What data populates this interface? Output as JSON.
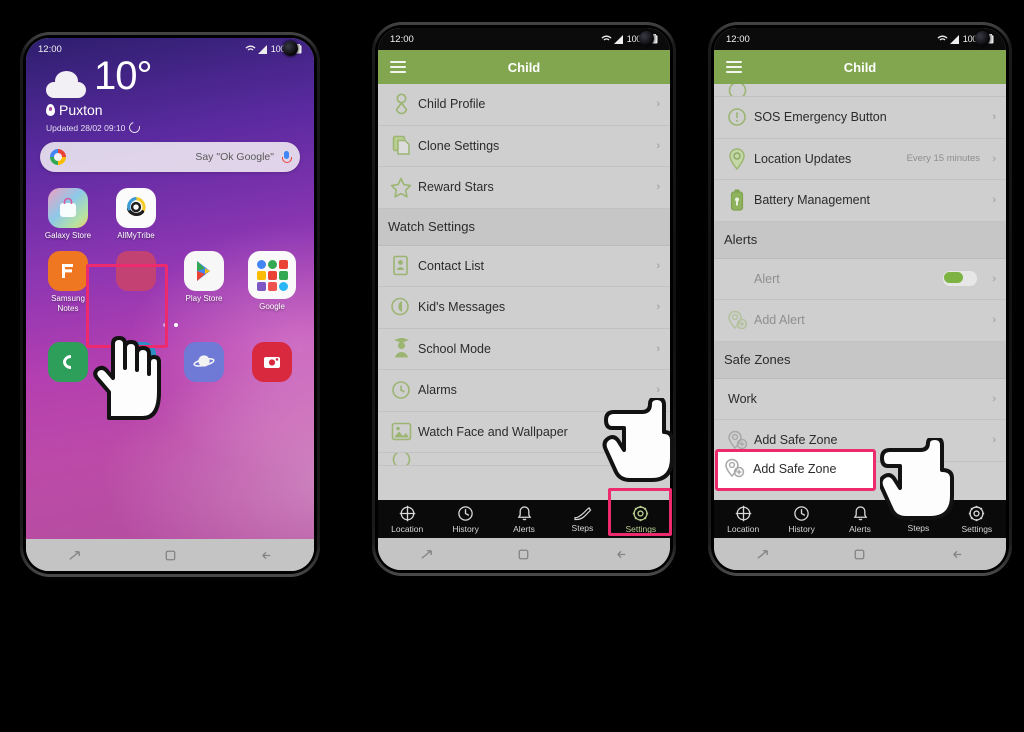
{
  "colors": {
    "brand_green": "#82a64f",
    "highlight_pink": "#ed2a6e",
    "icon_green": "#9cb573",
    "toggle_green": "#7cb342",
    "list_bg": "#cfcfcf",
    "tabbar_bg": "#0a0a0a"
  },
  "phone1": {
    "status": {
      "time": "12:00",
      "battery": "100%",
      "icons": "wifi-signal-battery"
    },
    "weather": {
      "temperature": "10°",
      "condition_icon": "cloud-icon",
      "location": "Puxton",
      "updated": "Updated 28/02 09:10"
    },
    "search": {
      "placeholder": "Say \"Ok Google\"",
      "logo": "google-g-icon",
      "mic": "microphone-icon"
    },
    "apps": [
      {
        "label": "Galaxy Store",
        "icon": "galaxy-store-icon"
      },
      {
        "label": "AllMyTribe",
        "icon": "allmytribe-icon",
        "highlighted": true
      },
      {
        "label": "Samsung Notes",
        "icon": "samsung-notes-icon"
      },
      {
        "label": "Play Store",
        "icon": "play-store-icon"
      },
      {
        "label": "Google",
        "icon": "google-folder-icon"
      }
    ],
    "dock": [
      {
        "label": "Phone",
        "icon": "phone-icon"
      },
      {
        "label": "Messages",
        "icon": "messages-icon"
      },
      {
        "label": "Internet",
        "icon": "internet-icon"
      },
      {
        "label": "Camera",
        "icon": "camera-icon"
      }
    ],
    "page_dots": 2,
    "active_dot": 2,
    "sysnav": [
      "recents-icon",
      "home-icon",
      "back-icon"
    ]
  },
  "phone2": {
    "status": {
      "time": "12:00",
      "battery": "100%"
    },
    "appbar": {
      "title": "Child",
      "menu_icon": "hamburger-icon"
    },
    "rows": [
      {
        "label": "Child Profile",
        "icon": "child-profile-icon",
        "type": "row"
      },
      {
        "label": "Clone Settings",
        "icon": "clone-settings-icon",
        "type": "row"
      },
      {
        "label": "Reward Stars",
        "icon": "star-icon",
        "type": "row"
      },
      {
        "label": "Watch Settings",
        "type": "section"
      },
      {
        "label": "Contact List",
        "icon": "contact-list-icon",
        "type": "row"
      },
      {
        "label": "Kid's Messages",
        "icon": "messages-bubble-icon",
        "type": "row"
      },
      {
        "label": "School Mode",
        "icon": "school-mode-icon",
        "type": "row"
      },
      {
        "label": "Alarms",
        "icon": "alarm-clock-icon",
        "type": "row"
      },
      {
        "label": "Watch Face and Wallpaper",
        "icon": "wallpaper-icon",
        "type": "row"
      }
    ],
    "tabs": [
      {
        "label": "Location",
        "icon": "crosshair-icon",
        "active": false
      },
      {
        "label": "History",
        "icon": "clock-icon",
        "active": false
      },
      {
        "label": "Alerts",
        "icon": "bell-icon",
        "active": false
      },
      {
        "label": "Steps",
        "icon": "shoe-icon",
        "active": false
      },
      {
        "label": "Settings",
        "icon": "gear-icon",
        "active": true
      }
    ],
    "highlight_target": "Settings",
    "sysnav": [
      "recents-icon",
      "home-icon",
      "back-icon"
    ]
  },
  "phone3": {
    "status": {
      "time": "12:00",
      "battery": "100%"
    },
    "appbar": {
      "title": "Child",
      "menu_icon": "hamburger-icon"
    },
    "rows": [
      {
        "type": "partial"
      },
      {
        "label": "SOS Emergency Button",
        "icon": "sos-icon",
        "type": "row"
      },
      {
        "label": "Location Updates",
        "icon": "location-pin-icon",
        "value": "Every 15 minutes",
        "type": "row"
      },
      {
        "label": "Battery Management",
        "icon": "battery-icon",
        "type": "row"
      },
      {
        "label": "Alerts",
        "type": "section"
      },
      {
        "label": "Alert",
        "type": "toggle",
        "toggle_on": true,
        "muted": true
      },
      {
        "label": "Add Alert",
        "icon": "add-alert-icon",
        "type": "row",
        "muted": true
      },
      {
        "label": "Safe Zones",
        "type": "section"
      },
      {
        "label": "Work",
        "type": "row"
      },
      {
        "label": "Add Safe Zone",
        "icon": "add-safe-zone-icon",
        "type": "row",
        "highlighted": true
      }
    ],
    "tabs": [
      {
        "label": "Location",
        "icon": "crosshair-icon",
        "active": false
      },
      {
        "label": "History",
        "icon": "clock-icon",
        "active": false
      },
      {
        "label": "Alerts",
        "icon": "bell-icon",
        "active": false
      },
      {
        "label": "Steps",
        "icon": "shoe-icon",
        "active": false
      },
      {
        "label": "Settings",
        "icon": "gear-icon",
        "active": false
      }
    ],
    "highlight_target": "Add Safe Zone",
    "sysnav": [
      "recents-icon",
      "home-icon",
      "back-icon"
    ]
  }
}
